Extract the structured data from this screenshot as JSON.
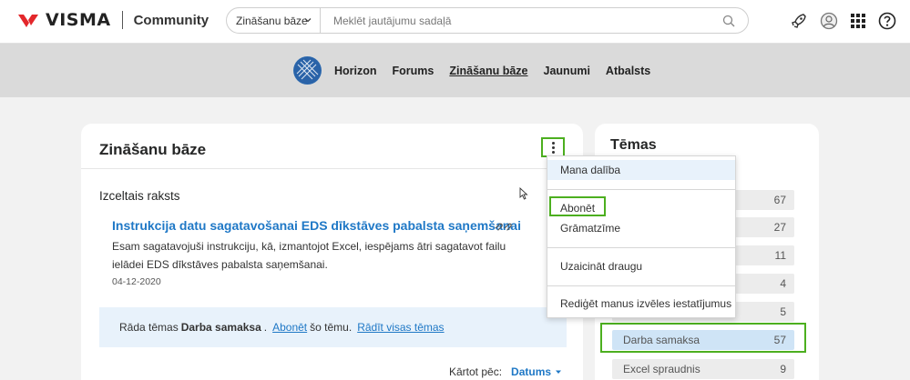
{
  "header": {
    "brand": "VISMA",
    "product": "Community",
    "search_scope": "Zināšanu bāze",
    "search_placeholder": "Meklēt jautājumu sadaļā",
    "icons": [
      "rocket-icon",
      "user-icon",
      "apps-grid-icon",
      "help-icon"
    ]
  },
  "nav": {
    "items": [
      {
        "label": "Horizon",
        "active": false
      },
      {
        "label": "Forums",
        "active": false
      },
      {
        "label": "Zināšanu bāze",
        "active": true
      },
      {
        "label": "Jaunumi",
        "active": false
      },
      {
        "label": "Atbalsts",
        "active": false
      }
    ]
  },
  "main": {
    "title": "Zināšanu bāze",
    "featured_label": "Izceltais raksts",
    "article": {
      "title": "Instrukcija datu sagatavošanai EDS dīkstāves pabalsta saņemšanai",
      "body": "Esam sagatavojuši instrukciju, kā, izmantojot Excel, iespējams ātri sagatavot failu ielādei EDS dīkstāves pabalsta saņemšanai.",
      "date": "04-12-2020"
    },
    "info": {
      "prefix": "Rāda tēmas",
      "topic": "Darba samaksa",
      "period": ".",
      "subscribe_link": "Abonēt",
      "middle": "šo tēmu.",
      "show_all_link": "Rādīt visas tēmas"
    },
    "sort": {
      "label": "Kārtot pēc:",
      "value": "Datums"
    }
  },
  "topics": {
    "title": "Tēmas",
    "items": [
      {
        "name": "",
        "count": "67"
      },
      {
        "name": "",
        "count": "27"
      },
      {
        "name": "",
        "count": "11"
      },
      {
        "name": "",
        "count": "4"
      },
      {
        "name": "",
        "count": "5"
      },
      {
        "name": "Darba samaksa",
        "count": "57",
        "active": true
      },
      {
        "name": "Excel spraudnis",
        "count": "9"
      }
    ]
  },
  "menu": {
    "items": [
      "Mana dalība",
      "Abonēt",
      "Grāmatzīme",
      "Uzaicināt draugu",
      "Rediģēt manus izvēles iestatījumus"
    ]
  },
  "colors": {
    "accent_blue": "#1f78c6",
    "highlight_green": "#4caf1f",
    "brand_red": "#e3272b",
    "active_row": "#cfe4f6"
  }
}
